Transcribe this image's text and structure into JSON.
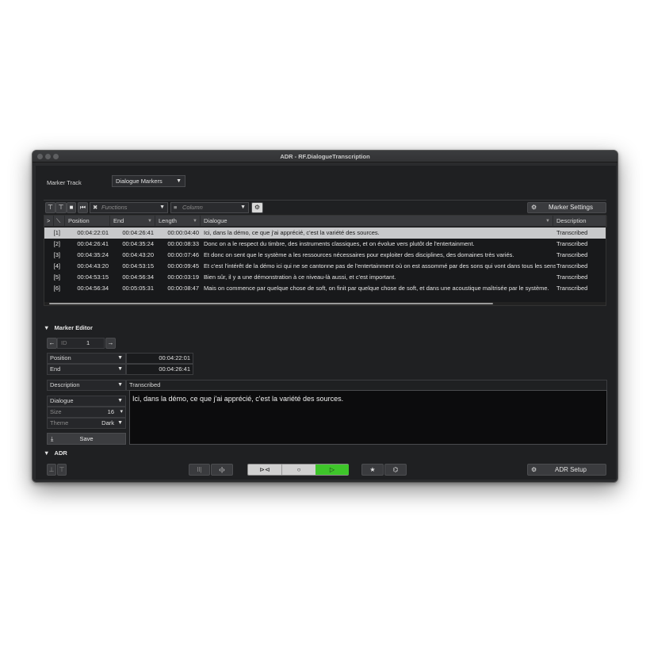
{
  "window": {
    "title": "ADR - RF.DialogueTranscription"
  },
  "marker_track": {
    "label": "Marker Track",
    "value": "Dialogue Markers"
  },
  "toolbar": {
    "functions_placeholder": "Functions",
    "column_placeholder": "Column",
    "marker_settings_label": "Marker Settings"
  },
  "table": {
    "headers": [
      "Position",
      "End",
      "Length",
      "Dialogue",
      "Description"
    ],
    "rows": [
      {
        "id": "[1]",
        "position": "00:04:22:01",
        "end": "00:04:26:41",
        "length": "00:00:04:40",
        "dialogue": "Ici, dans la démo, ce que j'ai apprécié, c'est la variété des sources.",
        "description": "Transcribed"
      },
      {
        "id": "[2]",
        "position": "00:04:26:41",
        "end": "00:04:35:24",
        "length": "00:00:08:33",
        "dialogue": "Donc on a le respect du timbre, des instruments classiques, et on évolue vers plutôt de l'entertainment.",
        "description": "Transcribed"
      },
      {
        "id": "[3]",
        "position": "00:04:35:24",
        "end": "00:04:43:20",
        "length": "00:00:07:46",
        "dialogue": "Et donc on sent que le système a les ressources nécessaires pour exploiter des disciplines, des domaines très variés.",
        "description": "Transcribed"
      },
      {
        "id": "[4]",
        "position": "00:04:43:20",
        "end": "00:04:53:15",
        "length": "00:00:09:45",
        "dialogue": "Et c'est l'intérêt de la démo ici qui ne se cantonne pas de l'entertainment où on est assommé par des sons qui vont dans tous les sens.",
        "description": "Transcribed"
      },
      {
        "id": "[5]",
        "position": "00:04:53:15",
        "end": "00:04:56:34",
        "length": "00:00:03:19",
        "dialogue": "Bien sûr, il y a une démonstration à ce niveau-là aussi, et c'est important.",
        "description": "Transcribed"
      },
      {
        "id": "[6]",
        "position": "00:04:56:34",
        "end": "00:05:05:31",
        "length": "00:00:08:47",
        "dialogue": "Mais on commence par quelque chose de soft, on finit par quelque chose de soft, et dans une acoustique maîtrisée par le système.",
        "description": "Transcribed"
      }
    ]
  },
  "marker_editor": {
    "title": "Marker Editor",
    "id_label": "ID",
    "id_value": "1",
    "position_label": "Position",
    "position_value": "00:04:22:01",
    "end_label": "End",
    "end_value": "00:04:26:41",
    "description_label": "Description",
    "description_value": "Transcribed",
    "dialogue_label": "Dialogue",
    "size_label": "Size",
    "size_value": "16",
    "theme_label": "Theme",
    "theme_value": "Dark",
    "save_label": "Save",
    "dialogue_text": "Ici, dans la démo, ce que j'ai apprécié, c'est la variété des sources."
  },
  "adr": {
    "title": "ADR",
    "setup_label": "ADR Setup",
    "play_color": "#3ec52a"
  }
}
